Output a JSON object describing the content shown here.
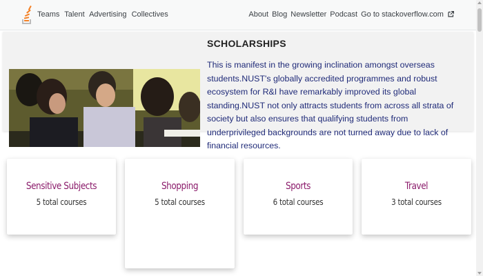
{
  "header": {
    "logo_icon": "stackoverflow-logo-icon",
    "left_nav": [
      "Teams",
      "Talent",
      "Advertising",
      "Collectives"
    ],
    "right_nav": [
      "About",
      "Blog",
      "Newsletter",
      "Podcast",
      "Go to stackoverflow.com"
    ],
    "external_icon": "external-link-icon"
  },
  "scholarship": {
    "title": "SCHOLARSHIPS",
    "body": "This is manifest in the growing inclination amongst overseas students.NUST's globally accredited programmes and robust ecosystem for R&I have remarkably improved its global standing.NUST not only attracts students from across all strata of society but also ensures that qualifying students from underprivileged backgrounds are not turned away due to lack of financial resources.",
    "image": "students-in-classroom-photo"
  },
  "categories": [
    {
      "name": "Sensitive Subjects",
      "count": "5 total courses"
    },
    {
      "name": "Shopping",
      "count": "5 total courses"
    },
    {
      "name": "Sports",
      "count": "6 total courses"
    },
    {
      "name": "Travel",
      "count": "3 total courses"
    }
  ],
  "colors": {
    "card_title": "#8b1c6b",
    "body_text": "#1f2a78",
    "logo_orange": "#f48024"
  }
}
